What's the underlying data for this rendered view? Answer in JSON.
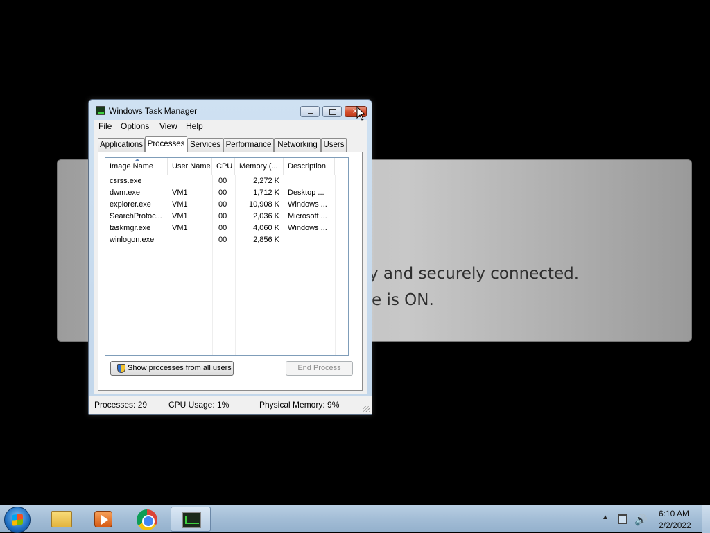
{
  "background": {
    "line1": "y and securely connected.",
    "line2": "e is ON."
  },
  "window": {
    "title": "Windows Task Manager",
    "menu": [
      "File",
      "Options",
      "View",
      "Help"
    ],
    "tabs": [
      "Applications",
      "Processes",
      "Services",
      "Performance",
      "Networking",
      "Users"
    ],
    "active_tab": "Processes",
    "columns": [
      "Image Name",
      "User Name",
      "CPU",
      "Memory (...",
      "Description"
    ],
    "rows": [
      {
        "image": "csrss.exe",
        "user": "",
        "cpu": "00",
        "memory": "2,272 K",
        "desc": ""
      },
      {
        "image": "dwm.exe",
        "user": "VM1",
        "cpu": "00",
        "memory": "1,712 K",
        "desc": "Desktop ..."
      },
      {
        "image": "explorer.exe",
        "user": "VM1",
        "cpu": "00",
        "memory": "10,908 K",
        "desc": "Windows ..."
      },
      {
        "image": "SearchProtoc...",
        "user": "VM1",
        "cpu": "00",
        "memory": "2,036 K",
        "desc": "Microsoft ..."
      },
      {
        "image": "taskmgr.exe",
        "user": "VM1",
        "cpu": "00",
        "memory": "4,060 K",
        "desc": "Windows ..."
      },
      {
        "image": "winlogon.exe",
        "user": "",
        "cpu": "00",
        "memory": "2,856 K",
        "desc": ""
      }
    ],
    "show_all_label": "Show processes from all users",
    "end_process_label": "End Process",
    "status": {
      "processes": "Processes: 29",
      "cpu": "CPU Usage: 1%",
      "memory": "Physical Memory: 9%"
    }
  },
  "taskbar": {
    "items": [
      "start-orb",
      "windows-explorer",
      "media-player",
      "google-chrome",
      "task-manager"
    ],
    "clock_time": "6:10 AM",
    "clock_date": "2/2/2022"
  },
  "colors": {
    "window_frame": "#c2d6ea",
    "close_button": "#c23b1c",
    "taskbar": "#a3bdd6"
  }
}
